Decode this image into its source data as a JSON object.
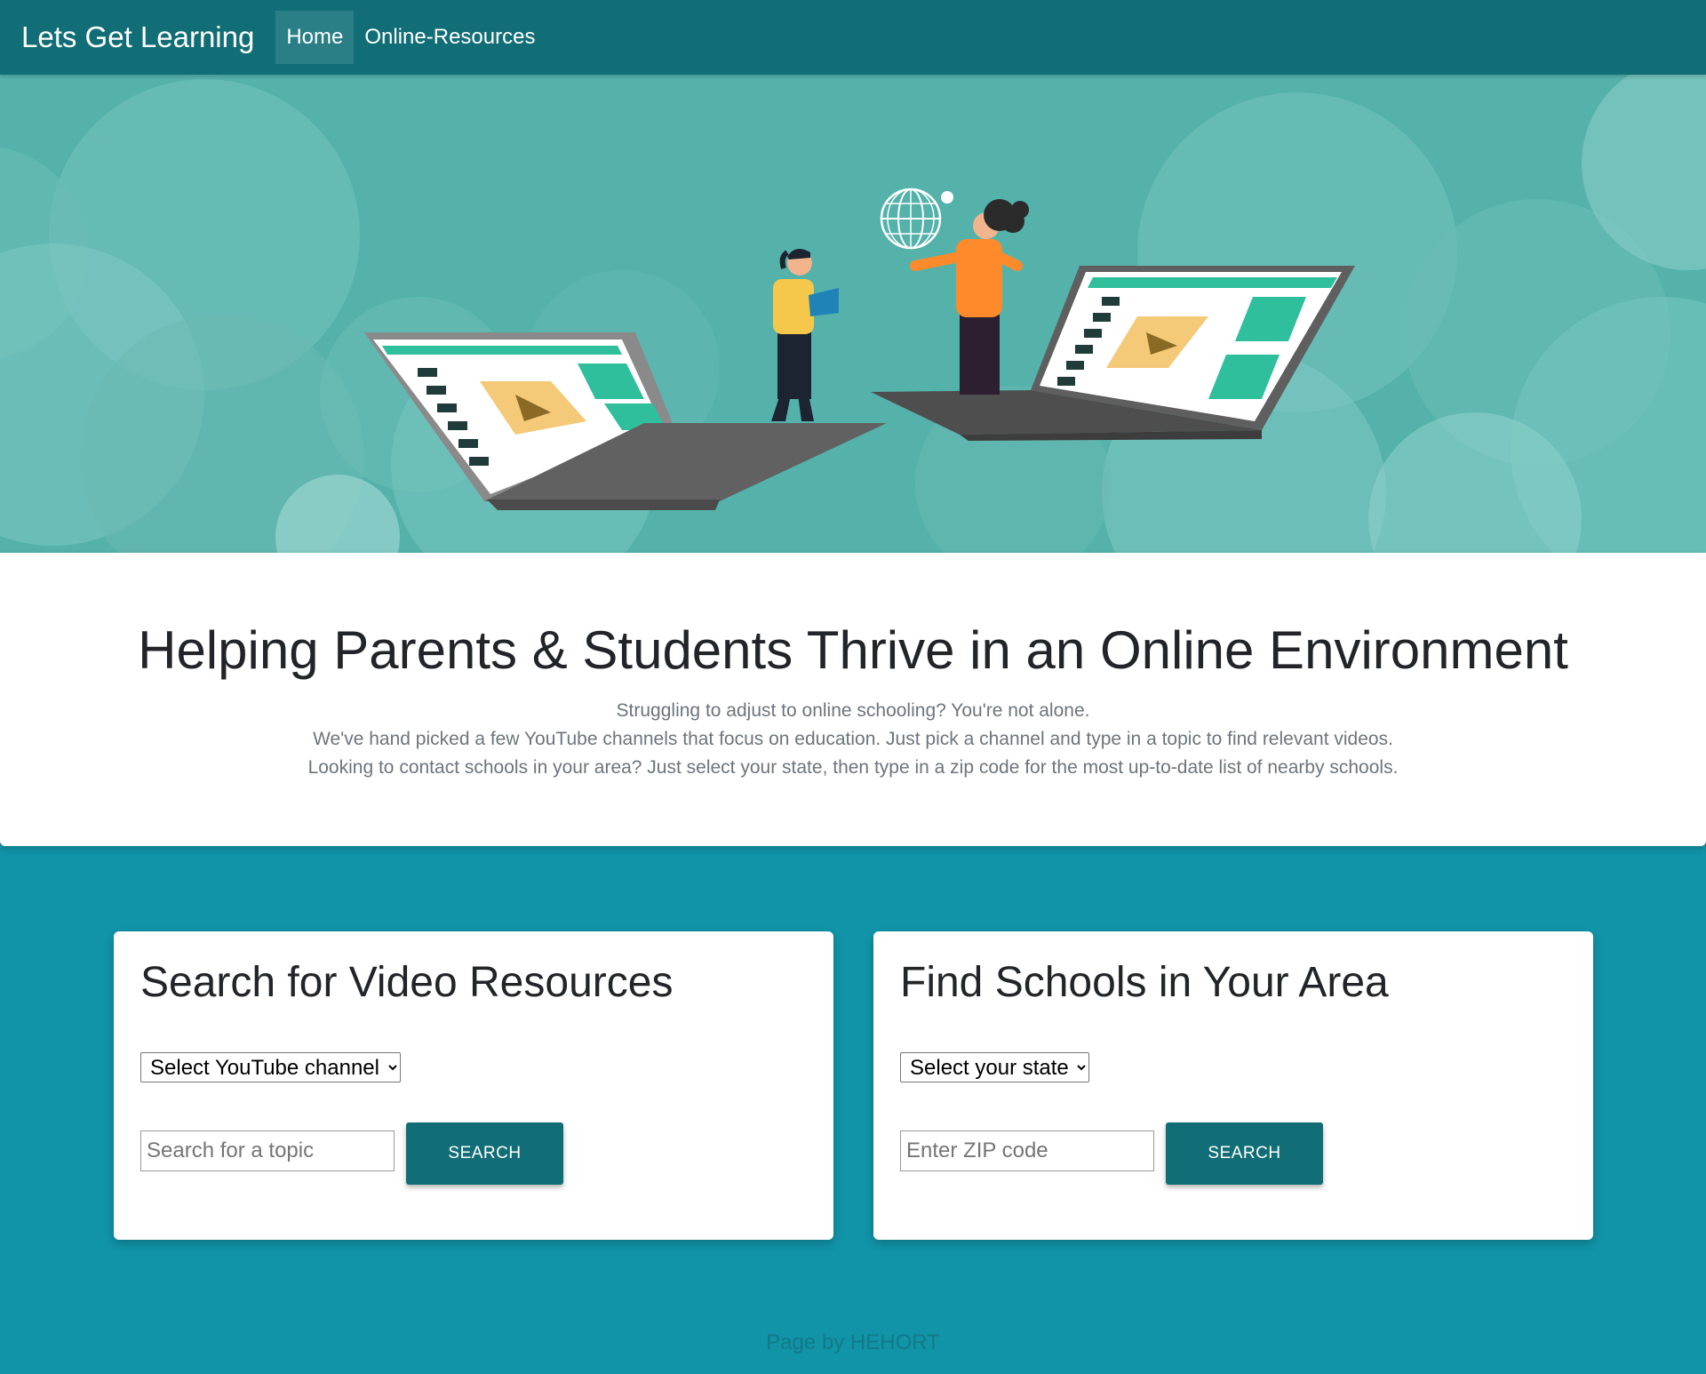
{
  "navbar": {
    "brand": "Lets Get Learning",
    "links": [
      {
        "label": "Home",
        "active": true
      },
      {
        "label": "Online-Resources",
        "active": false
      }
    ],
    "color": "#126e76"
  },
  "hero": {
    "background_color": "#54b2ab",
    "illustration": "two-people-laptops-video-learning"
  },
  "intro": {
    "title": "Helping Parents & Students Thrive in an Online Environment",
    "lines": [
      "Struggling to adjust to online schooling? You're not alone.",
      "We've hand picked a few YouTube channels that focus on education. Just pick a channel and type in a topic to find relevant videos.",
      "Looking to contact schools in your area? Just select your state, then type in a zip code for the most up-to-date list of nearby schools."
    ]
  },
  "video_card": {
    "title": "Search for Video Resources",
    "select_value": "Select YouTube channel",
    "input_placeholder": "Search for a topic",
    "button_label": "SEARCH"
  },
  "school_card": {
    "title": "Find Schools in Your Area",
    "select_value": "Select your state",
    "input_placeholder": "Enter ZIP code",
    "button_label": "SEARCH"
  },
  "footer": {
    "text": "Page by HEHORT"
  },
  "colors": {
    "page_background": "#1193a8",
    "button": "#126e76"
  }
}
